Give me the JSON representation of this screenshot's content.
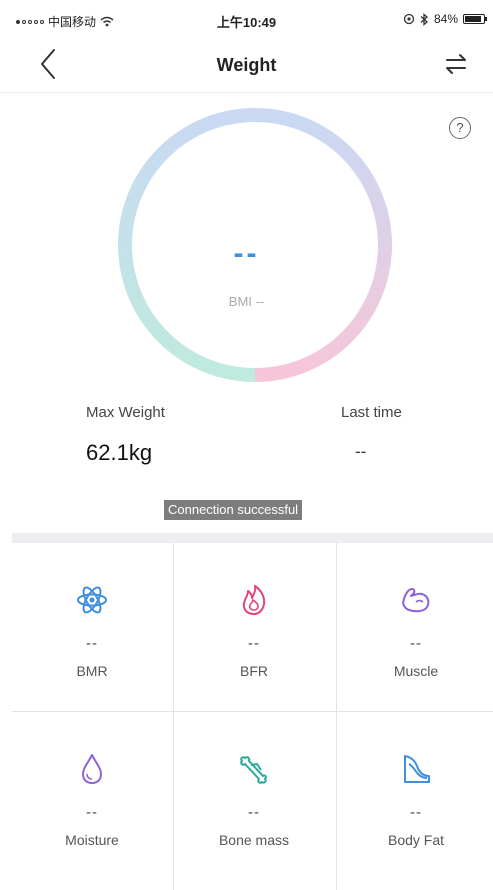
{
  "status_bar": {
    "carrier": "中国移动",
    "time": "上午10:49",
    "battery": "84%"
  },
  "nav": {
    "title": "Weight",
    "back_icon": "chevron-left-icon",
    "swap_icon": "swap-arrows-icon"
  },
  "help": {
    "label": "?"
  },
  "gauge": {
    "weight_value": "--",
    "bmi_text": "BMI --",
    "colors": {
      "blue": "#c7d8f3",
      "green": "#bfe9df",
      "pink": "#f6c6d6"
    }
  },
  "stats": {
    "max_weight_label": "Max Weight",
    "max_weight_value": "62.1kg",
    "last_time_label": "Last time",
    "last_time_value": "--"
  },
  "toast": {
    "text": "Connection successful"
  },
  "metrics": [
    {
      "label": "BMR",
      "value": "--",
      "icon": "atom-icon",
      "color": "#3d8fe0"
    },
    {
      "label": "BFR",
      "value": "--",
      "icon": "flame-icon",
      "color": "#e2457a"
    },
    {
      "label": "Muscle",
      "value": "--",
      "icon": "muscle-arm-icon",
      "color": "#8d63d8"
    },
    {
      "label": "Moisture",
      "value": "--",
      "icon": "water-drop-icon",
      "color": "#8d63d8"
    },
    {
      "label": "Bone mass",
      "value": "--",
      "icon": "bone-icon",
      "color": "#2aa99b"
    },
    {
      "label": "Body Fat",
      "value": "--",
      "icon": "body-shape-icon",
      "color": "#3d8fe0"
    }
  ]
}
